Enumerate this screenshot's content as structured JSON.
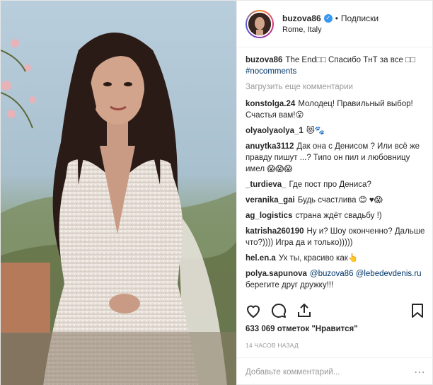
{
  "header": {
    "username": "buzova86",
    "follow_label": "Подписки",
    "location": "Rome, Italy"
  },
  "caption": {
    "username": "buzova86",
    "text": "The End□□ Спасибо ТнТ за все □□",
    "hashtag": "#nocomments"
  },
  "load_more": "Загрузить еще комментарии",
  "comments": [
    {
      "user": "konstolga.24",
      "text": "Молодец! Правильный выбор! Счастья вам!😮"
    },
    {
      "user": "olyaolyaolya_1",
      "text": "😻🐾"
    },
    {
      "user": "anuytka3112",
      "text": "Дак она с Денисом ? Или всё же правду пишут ...? Типо он пил и любовницу имел 😱😱😱"
    },
    {
      "user": "_turdieva_",
      "text": "Где пост про Дениса?"
    },
    {
      "user": "veranika_gai",
      "text": "Будь счастлива 😊 ♥😱"
    },
    {
      "user": "ag_logistics",
      "text": "страна ждёт свадьбу !)"
    },
    {
      "user": "katrisha260190",
      "text": "Ну и? Шоу оконченно? Дальше что?)))) Игра да и только)))))"
    },
    {
      "user": "hel.en.a",
      "text": "Ух ты, красиво как👆"
    },
    {
      "user": "polya.sapunova",
      "text": "@buzova86 @lebedevdenis.ru берегите друг дружку!!!"
    }
  ],
  "likes": "633 069 отметок \"Нравится\"",
  "time": "14 часов назад",
  "add_comment": {
    "placeholder": "Добавьте комментарий..."
  },
  "colors": {
    "link": "#003569",
    "muted": "#999999",
    "verified": "#3897f0"
  }
}
